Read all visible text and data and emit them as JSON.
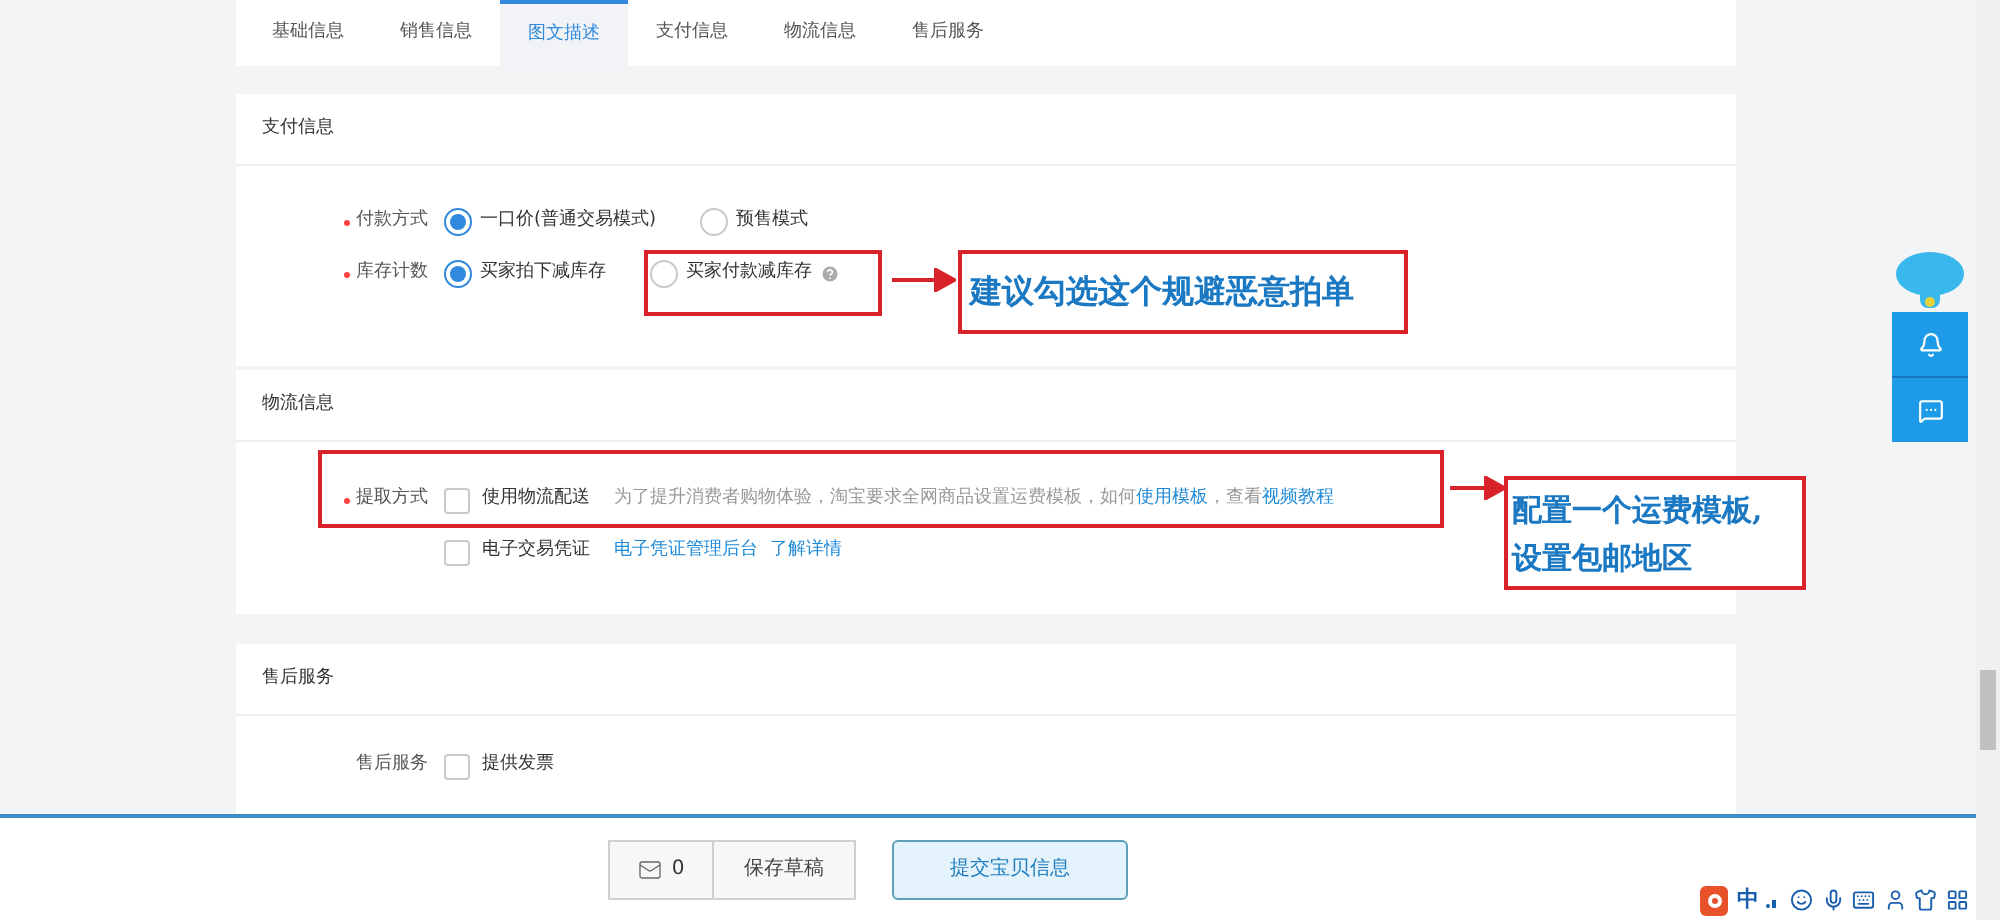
{
  "tabs": [
    {
      "label": "基础信息",
      "selected": false
    },
    {
      "label": "销售信息",
      "selected": false
    },
    {
      "label": "图文描述",
      "selected": true
    },
    {
      "label": "支付信息",
      "selected": false
    },
    {
      "label": "物流信息",
      "selected": false
    },
    {
      "label": "售后服务",
      "selected": false
    }
  ],
  "sections": [
    {
      "title": "支付信息",
      "rows": [
        {
          "kind": "radio",
          "label": "付款方式",
          "required": true,
          "options": [
            {
              "label": "一口价(普通交易模式)",
              "selected": true,
              "help": false
            },
            {
              "label": "预售模式",
              "selected": false,
              "help": false
            }
          ]
        },
        {
          "kind": "radio",
          "label": "库存计数",
          "required": true,
          "options": [
            {
              "label": "买家拍下减库存",
              "selected": true,
              "help": false
            },
            {
              "label": "买家付款减库存",
              "selected": false,
              "help": true
            }
          ]
        }
      ]
    },
    {
      "title": "物流信息",
      "rows": [
        {
          "kind": "checkbox",
          "label": "提取方式",
          "required": true,
          "options": [
            {
              "label": "使用物流配送",
              "checked": false,
              "note": [
                {
                  "text": "为了提升消费者购物体验，淘宝要求全网商品设置运费模板，如何",
                  "link": false
                },
                {
                  "text": "使用模板",
                  "link": true
                },
                {
                  "text": "，查看",
                  "link": false
                },
                {
                  "text": "视频教程",
                  "link": true
                }
              ]
            },
            {
              "label": "电子交易凭证",
              "checked": false,
              "note": [
                {
                  "text": "电子凭证管理后台",
                  "link": true
                },
                {
                  "text": "了解详情",
                  "link": true
                }
              ]
            }
          ]
        }
      ]
    },
    {
      "title": "售后服务",
      "rows": [
        {
          "kind": "checkbox",
          "label": "售后服务",
          "required": false,
          "options": [
            {
              "label": "提供发票",
              "checked": false
            }
          ]
        }
      ]
    }
  ],
  "callouts": [
    {
      "lines": [
        "建议勾选这个规避恶意拍单"
      ]
    },
    {
      "lines": [
        "配置一个运费模板,",
        "设置包邮地区"
      ]
    }
  ],
  "footer": {
    "message_count": "0",
    "save_label": "保存草稿",
    "submit_label": "提交宝贝信息"
  },
  "ime": {
    "mode": "中"
  }
}
